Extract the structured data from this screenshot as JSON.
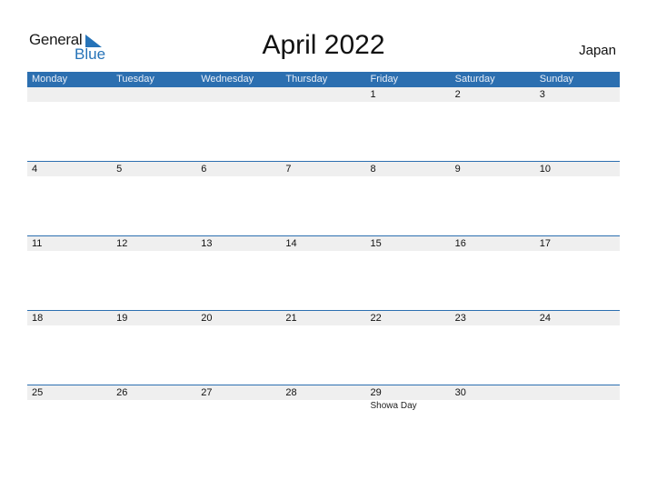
{
  "logo": {
    "general": "General",
    "blue": "Blue",
    "icon": "triangle-flag-icon"
  },
  "title": "April 2022",
  "country": "Japan",
  "colors": {
    "accent": "#2c6fb0",
    "strip": "#efefef",
    "logo_blue": "#2673b8"
  },
  "weekdays": [
    "Monday",
    "Tuesday",
    "Wednesday",
    "Thursday",
    "Friday",
    "Saturday",
    "Sunday"
  ],
  "weeks": [
    {
      "days": [
        "",
        "",
        "",
        "",
        "1",
        "2",
        "3"
      ],
      "events": [
        "",
        "",
        "",
        "",
        "",
        "",
        ""
      ]
    },
    {
      "days": [
        "4",
        "5",
        "6",
        "7",
        "8",
        "9",
        "10"
      ],
      "events": [
        "",
        "",
        "",
        "",
        "",
        "",
        ""
      ]
    },
    {
      "days": [
        "11",
        "12",
        "13",
        "14",
        "15",
        "16",
        "17"
      ],
      "events": [
        "",
        "",
        "",
        "",
        "",
        "",
        ""
      ]
    },
    {
      "days": [
        "18",
        "19",
        "20",
        "21",
        "22",
        "23",
        "24"
      ],
      "events": [
        "",
        "",
        "",
        "",
        "",
        "",
        ""
      ]
    },
    {
      "days": [
        "25",
        "26",
        "27",
        "28",
        "29",
        "30",
        ""
      ],
      "events": [
        "",
        "",
        "",
        "",
        "Showa Day",
        "",
        ""
      ]
    }
  ]
}
